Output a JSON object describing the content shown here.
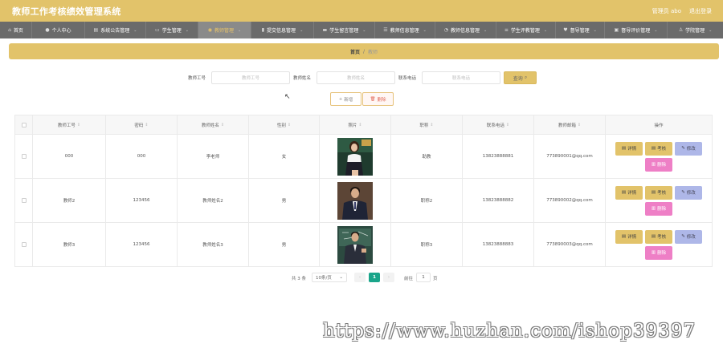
{
  "header": {
    "title": "教师工作考核绩效管理系统",
    "user_label": "管理员 abo",
    "logout_label": "退出登录"
  },
  "nav": {
    "items": [
      {
        "label": "首页",
        "icon": "home-icon"
      },
      {
        "label": "个人中心",
        "icon": "user-icon"
      },
      {
        "label": "系统公告管理",
        "icon": "doc-icon"
      },
      {
        "label": "学生管理",
        "icon": "chat-icon"
      },
      {
        "label": "教师管理",
        "icon": "location-icon",
        "active": true
      },
      {
        "label": "提交信息管理",
        "icon": "chart-icon"
      },
      {
        "label": "学生留言管理",
        "icon": "folder-icon"
      },
      {
        "label": "教师信息管理",
        "icon": "list-icon"
      },
      {
        "label": "教师信息管理",
        "icon": "clock-icon"
      },
      {
        "label": "学生评教管理",
        "icon": "stack-icon"
      },
      {
        "label": "督导管理",
        "icon": "heart-icon"
      },
      {
        "label": "督导评价管理",
        "icon": "camera-icon"
      },
      {
        "label": "学院管理",
        "icon": "person-icon"
      }
    ]
  },
  "breadcrumb": {
    "home": "首页",
    "separator": "/",
    "current": "教师"
  },
  "search": {
    "fields": [
      {
        "label": "教师工号",
        "placeholder": "教师工号"
      },
      {
        "label": "教师姓名",
        "placeholder": "教师姓名"
      },
      {
        "label": "联系电话",
        "placeholder": "联系电话"
      }
    ],
    "button_label": "查询"
  },
  "actions": {
    "add_label": "新增",
    "delete_label": "删除"
  },
  "table": {
    "columns": [
      "教师工号",
      "密码",
      "教师姓名",
      "性别",
      "照片",
      "职称",
      "联系电话",
      "教师邮箱",
      "操作"
    ],
    "rows": [
      {
        "id": "000",
        "password": "000",
        "name": "李老师",
        "gender": "女",
        "title": "助教",
        "phone": "13823888881",
        "email": "773890001@qq.com",
        "photo": "woman-portrait"
      },
      {
        "id": "教师2",
        "password": "123456",
        "name": "教师姓名2",
        "gender": "男",
        "title": "职称2",
        "phone": "13823888882",
        "email": "773890002@qq.com",
        "photo": "man-portrait"
      },
      {
        "id": "教师3",
        "password": "123456",
        "name": "教师姓名3",
        "gender": "男",
        "title": "职称3",
        "phone": "13823888883",
        "email": "773890003@qq.com",
        "photo": "man-chalkboard-portrait"
      }
    ],
    "row_actions": {
      "detail": "详情",
      "exam": "考核",
      "edit": "修改",
      "delete": "删除"
    }
  },
  "pagination": {
    "total": "共 3 条",
    "page_size": "10条/页",
    "current_page": "1",
    "goto_label": "前往",
    "goto_value": "1",
    "goto_unit": "页"
  },
  "watermark": "https://www.huzhan.com/ishop39397",
  "colors": {
    "accent": "#e2c36a",
    "nav_bg": "#6b6b6b",
    "edit_button": "#aeb7e8",
    "delete_button": "#ee7fc6",
    "page_active": "#1aa58a"
  }
}
